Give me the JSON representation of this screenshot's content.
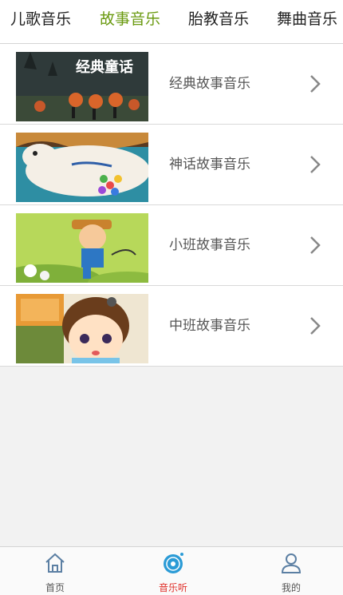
{
  "top_tabs": [
    {
      "label": "儿歌音乐",
      "active": false
    },
    {
      "label": "故事音乐",
      "active": true
    },
    {
      "label": "胎教音乐",
      "active": false
    },
    {
      "label": "舞曲音乐",
      "active": false
    }
  ],
  "list": [
    {
      "label": "经典故事音乐",
      "thumb_text": "经典童话",
      "thumb": "halloween-pumpkin-parade"
    },
    {
      "label": "神话故事音乐",
      "thumb": "white-deer-cartoon"
    },
    {
      "label": "小班故事音乐",
      "thumb": "farmer-boy-cartoon"
    },
    {
      "label": "中班故事音乐",
      "thumb": "girl-face-cartoon"
    }
  ],
  "bottom_nav": [
    {
      "label": "首页",
      "icon": "home-icon",
      "active": false
    },
    {
      "label": "音乐听",
      "icon": "music-disc-icon",
      "active": true
    },
    {
      "label": "我的",
      "icon": "user-icon",
      "active": false
    }
  ],
  "colors": {
    "active_tab": "#6a9a10",
    "active_nav": "#e0302a",
    "nav_icon": "#5b7fa3"
  }
}
